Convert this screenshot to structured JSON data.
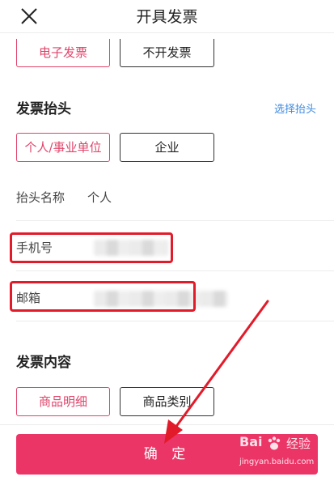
{
  "header": {
    "title": "开具发票",
    "close_icon": "close-icon"
  },
  "invoice_type": {
    "options": [
      "电子发票",
      "不开发票"
    ],
    "selected": "电子发票"
  },
  "invoice_header": {
    "section_title": "发票抬头",
    "select_link": "选择抬头",
    "options": [
      "个人/事业单位",
      "企业"
    ],
    "selected": "个人/事业单位",
    "name_label": "抬头名称",
    "name_value": "个人",
    "phone_label": "手机号",
    "email_label": "邮箱"
  },
  "invoice_content": {
    "section_title": "发票内容",
    "options": [
      "商品明细",
      "商品类别"
    ],
    "selected": "商品明细"
  },
  "footer": {
    "confirm_label": "确 定"
  },
  "watermark": {
    "brand": "Bai",
    "product": "经验",
    "url": "jingyan.baidu.com"
  },
  "colors": {
    "accent": "#e0446a",
    "confirm_bg": "#ec3567",
    "link": "#3d8ae0",
    "annotation_red": "#e21b2a"
  }
}
